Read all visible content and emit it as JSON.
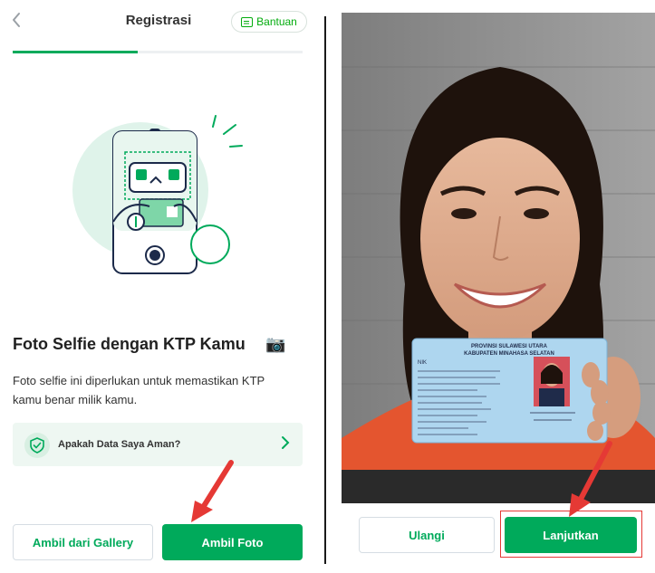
{
  "header": {
    "back_icon": "chevron-left-icon",
    "title": "Registrasi",
    "help_label": "Bantuan",
    "progress": 0.43
  },
  "content": {
    "heading": "Foto Selfie dengan KTP Kamu",
    "heading_emoji": "📷",
    "description": "Foto selfie ini diperlukan untuk memastikan KTP kamu benar milik kamu.",
    "safety_card_label": "Apakah Data Saya Aman?"
  },
  "buttons": {
    "gallery": "Ambil dari Gallery",
    "take_photo": "Ambil Foto",
    "retry": "Ulangi",
    "continue": "Lanjutkan"
  },
  "ktp": {
    "province": "PROVINSI SULAWESI UTARA",
    "regency": "KABUPATEN MINAHASA SELATAN",
    "nik_label": "NIK"
  },
  "colors": {
    "primary": "#00aa5b",
    "brand_green": "#03ac0e",
    "annotation_red": "#e53935",
    "card_bg": "#eef7f2"
  }
}
